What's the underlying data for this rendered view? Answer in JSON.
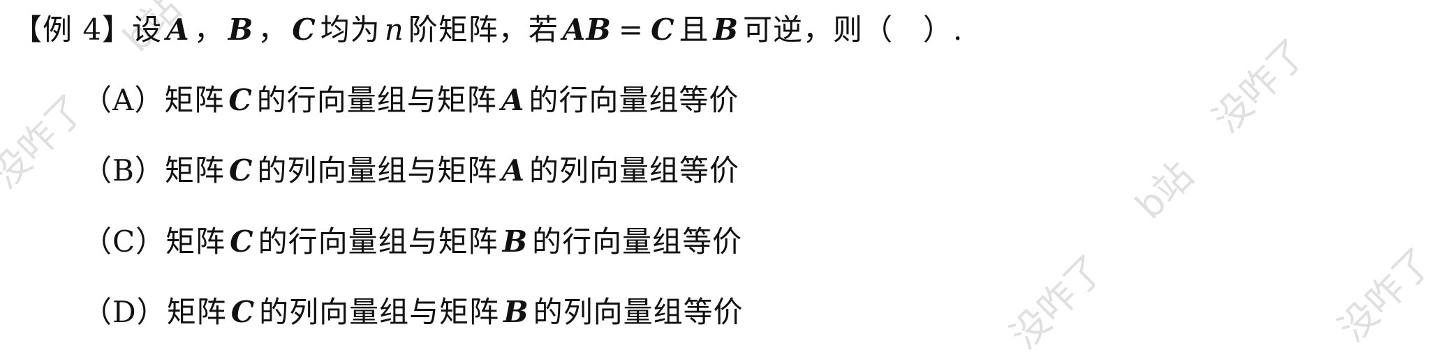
{
  "watermarks": {
    "wm1": "b站",
    "wm2": "没咋了",
    "wm3": "b站",
    "wm4": "没咋了",
    "wm5": "没咋了",
    "wm6": "没咋了"
  },
  "question": {
    "bracket_open": "【",
    "example_label": "例 4",
    "bracket_close": "】",
    "t1": "设",
    "A": "A",
    "c1": "，",
    "B": "B",
    "c2": "，",
    "C": "C",
    "t2": "均为",
    "n": "n",
    "t3": "阶矩阵，若",
    "AB": "AB",
    "eq": "=",
    "C2": "C",
    "t4": "且",
    "B2": "B",
    "t5": "可逆，则（　）."
  },
  "options": {
    "a": {
      "label": "（A）",
      "pre": "矩阵",
      "m1": "C",
      "mid": "的行向量组与矩阵",
      "m2": "A",
      "post": "的行向量组等价"
    },
    "b": {
      "label": "（B）",
      "pre": "矩阵",
      "m1": "C",
      "mid": "的列向量组与矩阵",
      "m2": "A",
      "post": "的列向量组等价"
    },
    "c": {
      "label": "（C）",
      "pre": "矩阵",
      "m1": "C",
      "mid": "的行向量组与矩阵",
      "m2": "B",
      "post": "的行向量组等价"
    },
    "d": {
      "label": "（D）",
      "pre": "矩阵",
      "m1": "C",
      "mid": "的列向量组与矩阵",
      "m2": "B",
      "post": "的列向量组等价"
    }
  }
}
